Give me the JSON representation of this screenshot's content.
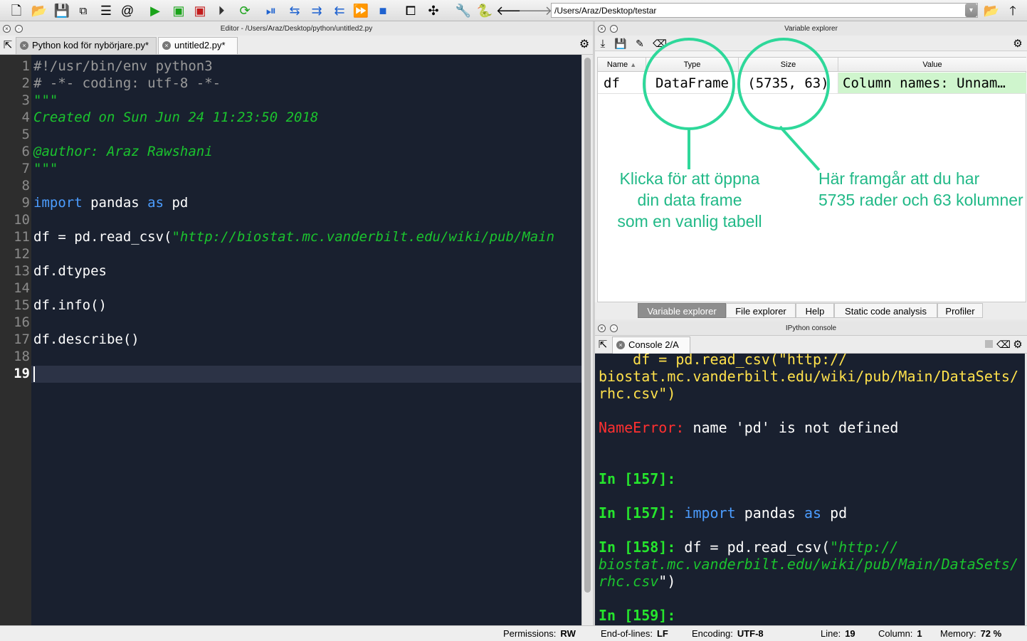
{
  "toolbar": {
    "icons": [
      "new-file-icon",
      "open-file-icon",
      "save-icon",
      "save-all-icon",
      "list-icon",
      "at-icon",
      "run-icon",
      "run-cell-icon",
      "run-cell-advance-icon",
      "run-selection-icon",
      "rerun-icon",
      "debug-icon",
      "step-icon",
      "step-into-icon",
      "step-return-icon",
      "continue-icon",
      "stop-icon",
      "maximize-pane-icon",
      "fullscreen-icon",
      "wrench-icon",
      "python-icon",
      "back-arrow-icon",
      "forward-arrow-icon"
    ],
    "working_dir": "/Users/Araz/Desktop/testar"
  },
  "editor": {
    "title": "Editor - /Users/Araz/Desktop/python/untitled2.py",
    "tabs": [
      {
        "label": "Python kod för nybörjare.py*",
        "active": false
      },
      {
        "label": "untitled2.py*",
        "active": true
      }
    ],
    "line_numbers": [
      "1",
      "2",
      "3",
      "4",
      "5",
      "6",
      "7",
      "8",
      "9",
      "10",
      "11",
      "12",
      "13",
      "14",
      "15",
      "16",
      "17",
      "18",
      "19"
    ],
    "current_line": "19",
    "code": {
      "l1": "#!/usr/bin/env python3",
      "l2": "# -*- coding: utf-8 -*-",
      "l3": "\"\"\"",
      "l4": "Created on Sun Jun 24 11:23:50 2018",
      "l6": "@author: Araz Rawshani",
      "l7": "\"\"\"",
      "l9_kw1": "import",
      "l9_mid": " pandas ",
      "l9_kw2": "as",
      "l9_end": " pd",
      "l11_pre": "df = pd.read_csv(",
      "l11_str": "\"http://biostat.mc.vanderbilt.edu/wiki/pub/Main",
      "l13": "df.dtypes",
      "l15": "df.info()",
      "l17": "df.describe()"
    }
  },
  "variable_explorer": {
    "title": "Variable explorer",
    "columns": {
      "name": "Name",
      "sort_indicator": "▲",
      "type": "Type",
      "size": "Size",
      "value": "Value"
    },
    "rows": [
      {
        "name": "df",
        "type": "DataFrame",
        "size": "(5735, 63)",
        "value": "Column names: Unnam…",
        "highlight_color": "#cff5cd"
      }
    ],
    "annotations": {
      "type_note": [
        "Klicka för att öppna",
        "din data frame",
        "som en vanlig tabell"
      ],
      "size_note": [
        "Här framgår att du har",
        "5735 rader och 63 kolumner"
      ]
    },
    "accent_color": "#2ed89a",
    "bottom_tabs": [
      {
        "label": "Variable explorer",
        "selected": true
      },
      {
        "label": "File explorer",
        "selected": false
      },
      {
        "label": "Help",
        "selected": false
      },
      {
        "label": "Static code analysis",
        "selected": false
      },
      {
        "label": "Profiler",
        "selected": false
      }
    ]
  },
  "console": {
    "title": "IPython console",
    "tab_label": "Console 2/A",
    "lines": {
      "c1": "    df = pd.read_csv(\"http://",
      "c2": "biostat.mc.vanderbilt.edu/wiki/pub/Main/DataSets/",
      "c3": "rhc.csv\")",
      "err_name": "NameError:",
      "err_msg": " name 'pd' is not defined",
      "p157a": "In [157]:",
      "p157b": "In [157]:",
      "in157_kw1": "import",
      "in157_mid": " pandas ",
      "in157_kw2": "as",
      "in157_end": " pd",
      "p158": "In [158]:",
      "in158_pre": " df = pd.read_csv(",
      "in158_q": "\"",
      "in158_s1": "http://",
      "in158_s2": "biostat.mc.vanderbilt.edu/wiki/pub/Main/DataSets/",
      "in158_s3": "rhc.csv",
      "in158_end": "\")",
      "p159": "In [159]:"
    }
  },
  "statusbar": {
    "permissions_label": "Permissions:",
    "permissions_value": "RW",
    "eol_label": "End-of-lines:",
    "eol_value": "LF",
    "encoding_label": "Encoding:",
    "encoding_value": "UTF-8",
    "line_label": "Line:",
    "line_value": "19",
    "column_label": "Column:",
    "column_value": "1",
    "memory_label": "Memory:",
    "memory_value": "72 %"
  }
}
